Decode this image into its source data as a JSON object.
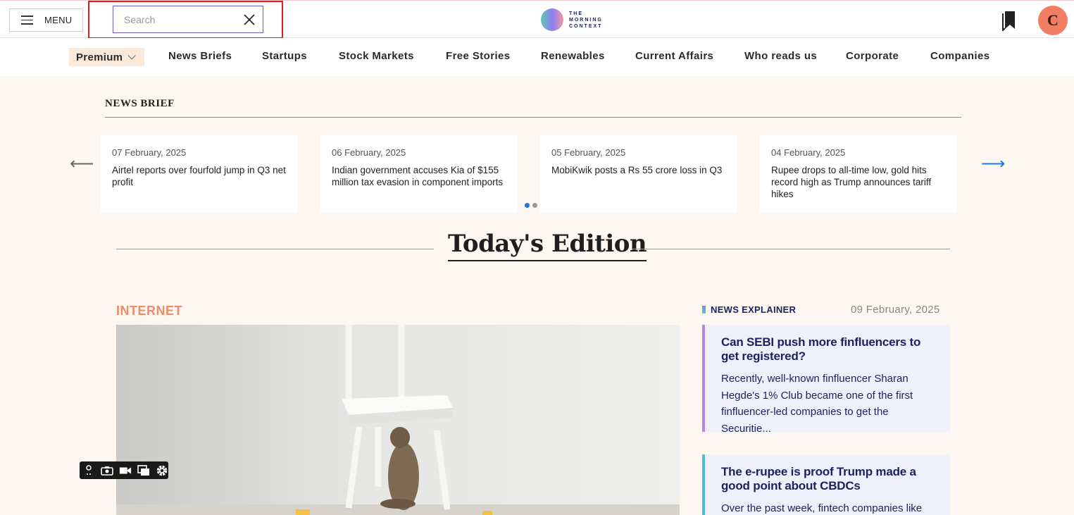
{
  "header": {
    "menu_label": "MENU",
    "search_placeholder": "Search",
    "search_value": "",
    "logo_lines": [
      "THE",
      "MORNING",
      "CONTEXT"
    ],
    "avatar_initial": "C"
  },
  "nav": {
    "premium_label": "Premium",
    "items": [
      "News Briefs",
      "Startups",
      "Stock Markets",
      "Free Stories",
      "Renewables",
      "Current Affairs",
      "Who reads us",
      "Corporate",
      "Companies"
    ]
  },
  "news_brief": {
    "heading": "NEWS BRIEF",
    "prev_arrow": "⟵",
    "next_arrow": "⟶",
    "cards": [
      {
        "date": "07 February, 2025",
        "title": "Airtel reports over fourfold jump in Q3 net profit"
      },
      {
        "date": "06 February, 2025",
        "title": "Indian government accuses Kia of $155 million tax evasion in component imports"
      },
      {
        "date": "05 February, 2025",
        "title": "MobiKwik posts a Rs 55 crore loss in Q3"
      },
      {
        "date": "04 February, 2025",
        "title": "Rupee drops to all-time low, gold hits record high as Trump announces tariff hikes"
      }
    ]
  },
  "edition": {
    "title": "Today's Edition"
  },
  "main_story": {
    "category": "INTERNET"
  },
  "explainer": {
    "tag": "NEWS EXPLAINER",
    "date": "09 February, 2025",
    "items": [
      {
        "headline": "Can SEBI push more finfluencers to get registered?",
        "summary": "Recently, well-known finfluencer Sharan Hegde's 1% Club became one of the first finfluencer-led companies to get the Securitie..."
      },
      {
        "headline": "The e-rupee is proof Trump made a good point about CBDCs",
        "summary": "Over the past week, fintech companies like"
      }
    ]
  },
  "colors": {
    "accent_category": "#f08c69",
    "navy": "#1c2260",
    "highlight_border": "#e31b1b",
    "avatar_bg": "#f27d63"
  }
}
